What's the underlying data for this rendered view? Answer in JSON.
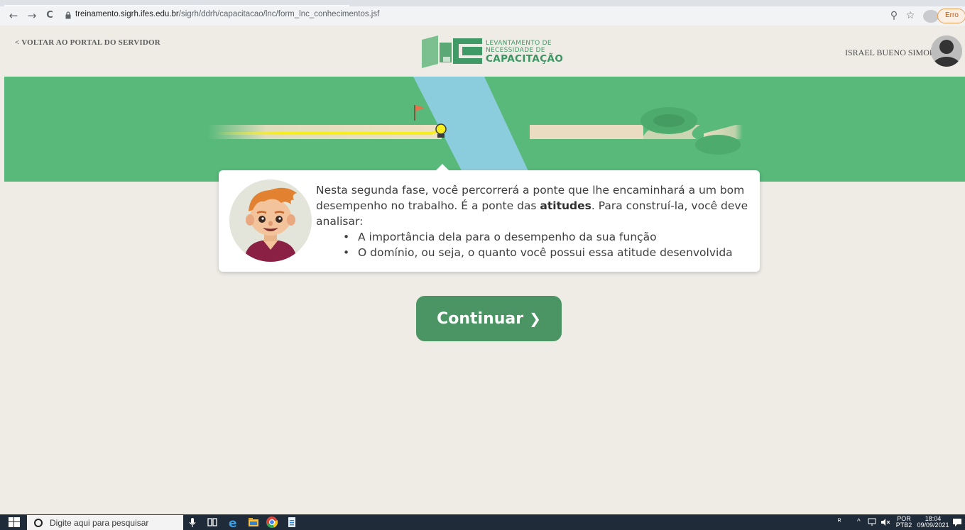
{
  "browser": {
    "back_icon": "←",
    "forward_icon": "→",
    "reload_icon": "C",
    "url_host": "treinamento.sigrh.ifes.edu.br",
    "url_path": "/sigrh/ddrh/capacitacao/lnc/form_lnc_conhecimentos.jsf",
    "zoom_icon": "⚲",
    "star_icon": "☆",
    "error_label": "Erro"
  },
  "header": {
    "back_link": "< VOLTAR AO PORTAL DO SERVIDOR",
    "logo_line1": "LEVANTAMENTO DE",
    "logo_line2": "NECESSIDADE DE",
    "logo_line3": "CAPACITAÇÃO",
    "user_name": "ISRAEL BUENO SIMOES"
  },
  "dialog": {
    "line1": "Nesta segunda fase, você percorrerá a ponte que lhe encaminhará a um bom",
    "line2_pre": "desempenho no trabalho. É a ponte das ",
    "line2_bold": "atitudes",
    "line2_post": ". Para construí-la, você deve",
    "line3": "analisar:",
    "bullets": [
      "A importância dela para o desempenho da sua função",
      "O domínio, ou seja, o quanto você possui essa atitude desenvolvida"
    ]
  },
  "continue_button": {
    "label": "Continuar",
    "chevron": "❯"
  },
  "taskbar": {
    "search_placeholder": "Digite aqui para pesquisar",
    "lang_line1": "POR",
    "lang_line2": "PTB2",
    "time": "18:04",
    "date": "09/09/2021"
  },
  "colors": {
    "banner_green": "#58b97b",
    "river_blue": "#8ccddd",
    "button_green": "#4b9564",
    "path_yellow": "#f6ee1f",
    "background": "#efece6"
  }
}
